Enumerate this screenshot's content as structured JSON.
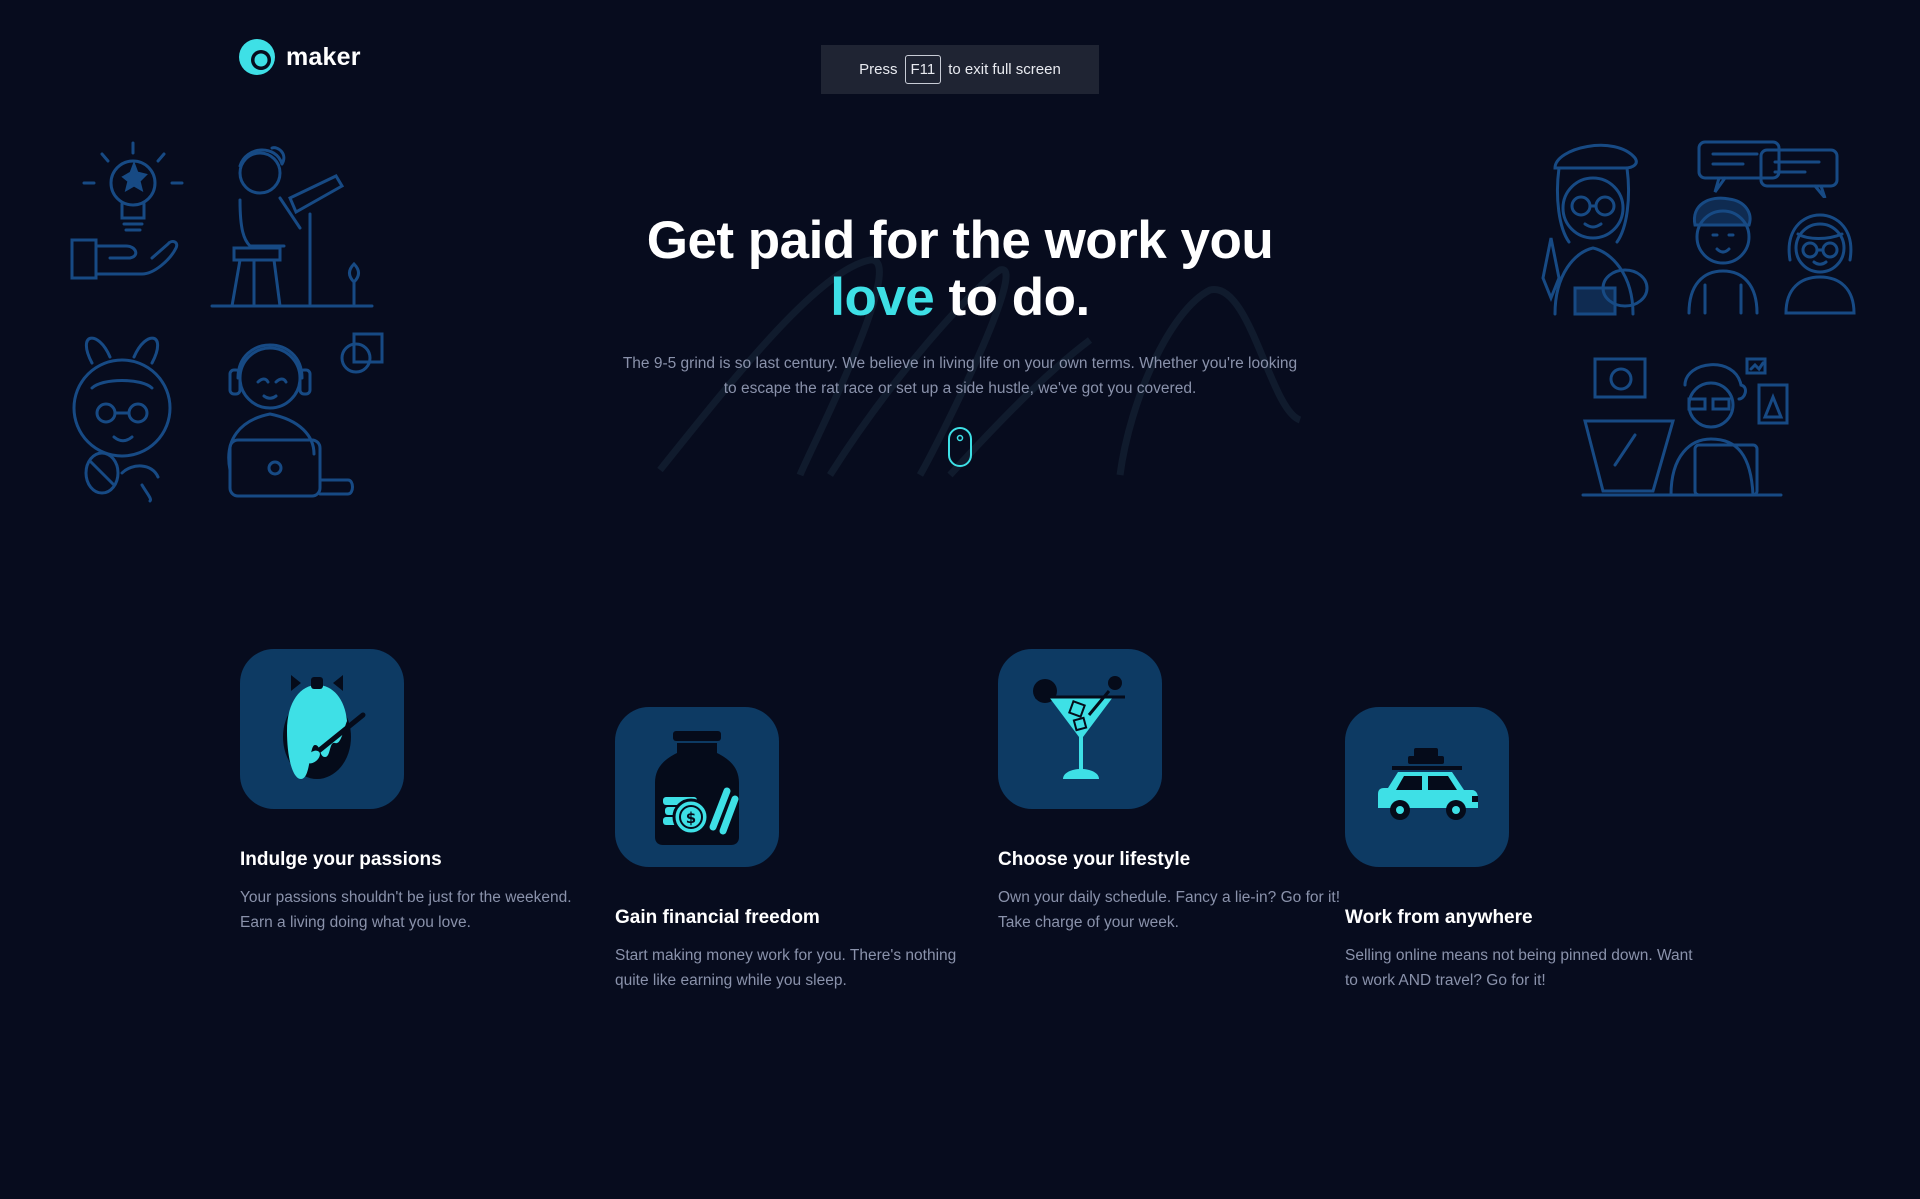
{
  "brand": {
    "name": "maker",
    "accent_color": "#3ee0e6",
    "background_color": "#070c1e",
    "card_color": "#0d3a63"
  },
  "fullscreen_notice": {
    "prefix": "Press",
    "key": "F11",
    "suffix": "to exit full screen"
  },
  "hero": {
    "title_line1": "Get paid for the work you",
    "title_accent": "love",
    "title_rest": "to do.",
    "subtitle": "The 9-5 grind is so last century. We believe in living life on your own terms. Whether you're looking to escape the rat race or set up a side hustle, we've got you covered.",
    "scroll_icon": "mouse-scroll-icon"
  },
  "illustrations": {
    "left": [
      "lightbulb-hand-icon",
      "artist-at-easel-icon",
      "bunny-costume-person-icon",
      "headset-laptop-person-icon"
    ],
    "right": [
      "painter-palette-icon",
      "chat-bubbles-icon",
      "person-icon",
      "woman-glasses-icon",
      "designer-at-desk-icon"
    ]
  },
  "features": [
    {
      "icon": "paint-egg-icon",
      "title": "Indulge your passions",
      "text": "Your passions shouldn't be just for the weekend. Earn a living doing what you love."
    },
    {
      "icon": "money-jar-icon",
      "title": "Gain financial freedom",
      "text": "Start making money work for you. There's nothing quite like earning while you sleep."
    },
    {
      "icon": "cocktail-icon",
      "title": "Choose your lifestyle",
      "text": "Own your daily schedule. Fancy a lie-in? Go for it! Take charge of your week."
    },
    {
      "icon": "car-roof-luggage-icon",
      "title": "Work from anywhere",
      "text": "Selling online means not being pinned down. Want to work AND travel? Go for it!"
    }
  ]
}
